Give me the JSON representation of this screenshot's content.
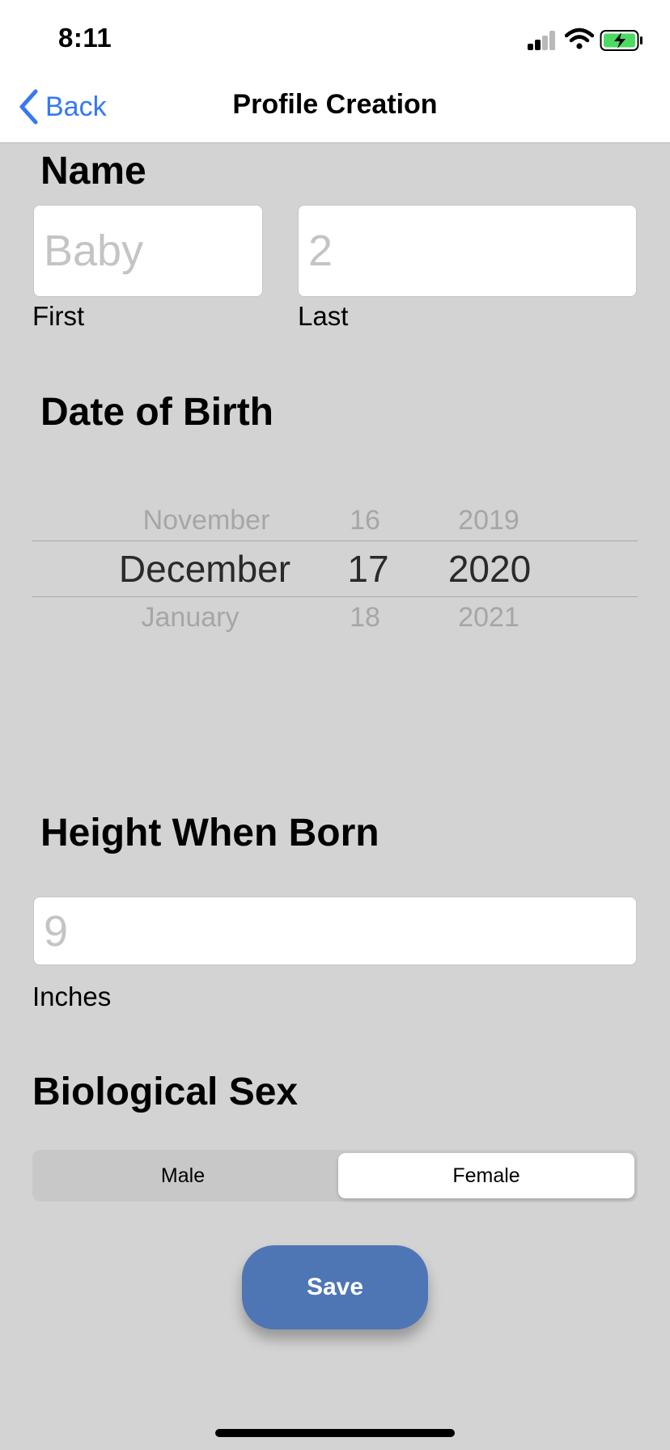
{
  "status_bar": {
    "time": "8:11"
  },
  "nav": {
    "back_label": "Back",
    "title": "Profile Creation"
  },
  "name_section": {
    "heading": "Name",
    "first_placeholder": "Baby",
    "last_placeholder": "2",
    "first_label": "First",
    "last_label": "Last"
  },
  "dob_section": {
    "heading": "Date of Birth",
    "month": {
      "prev": "November",
      "selected": "December",
      "next": "January"
    },
    "day": {
      "prev": "16",
      "selected": "17",
      "next": "18"
    },
    "year": {
      "prev": "2019",
      "selected": "2020",
      "next": "2021"
    }
  },
  "height_section": {
    "heading": "Height When Born",
    "placeholder": "9",
    "unit_label": "Inches"
  },
  "sex_section": {
    "heading": "Biological Sex",
    "options": [
      "Male",
      "Female"
    ],
    "selected": "Female"
  },
  "save_label": "Save",
  "colors": {
    "accent": "#3478f6",
    "save": "#4f76b4",
    "background": "#d3d3d3",
    "battery": "#4cd964"
  }
}
